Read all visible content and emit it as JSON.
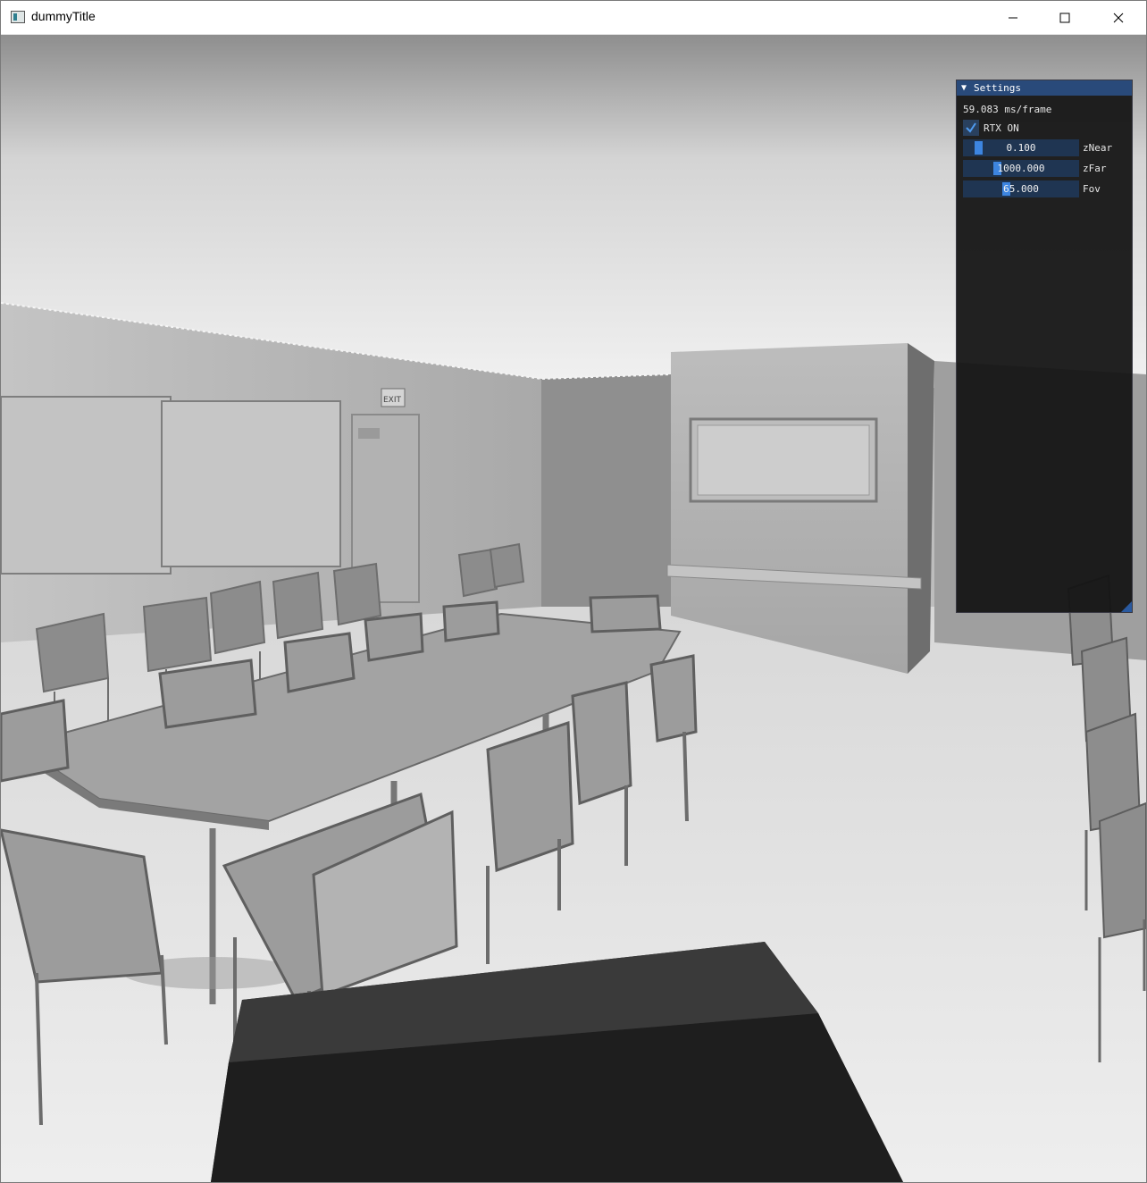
{
  "window": {
    "title": "dummyTitle",
    "controls": [
      "minimize-icon",
      "maximize-icon",
      "close-icon"
    ]
  },
  "scene": {
    "exit_sign": "EXIT"
  },
  "settings": {
    "title": "Settings",
    "frame_time": "59.083 ms/frame",
    "rtx": {
      "label": "RTX ON",
      "checked": true
    },
    "sliders": [
      {
        "label": "zNear",
        "value": "0.100",
        "fraction": 0.1
      },
      {
        "label": "zFar",
        "value": "1000.000",
        "fraction": 0.28
      },
      {
        "label": "Fov",
        "value": "65.000",
        "fraction": 0.36
      }
    ]
  },
  "colors": {
    "panel_header": "#294a7a",
    "slider_frame": "#1f3552",
    "slider_grab": "#3d85e0",
    "panel_bg": "#141414"
  }
}
